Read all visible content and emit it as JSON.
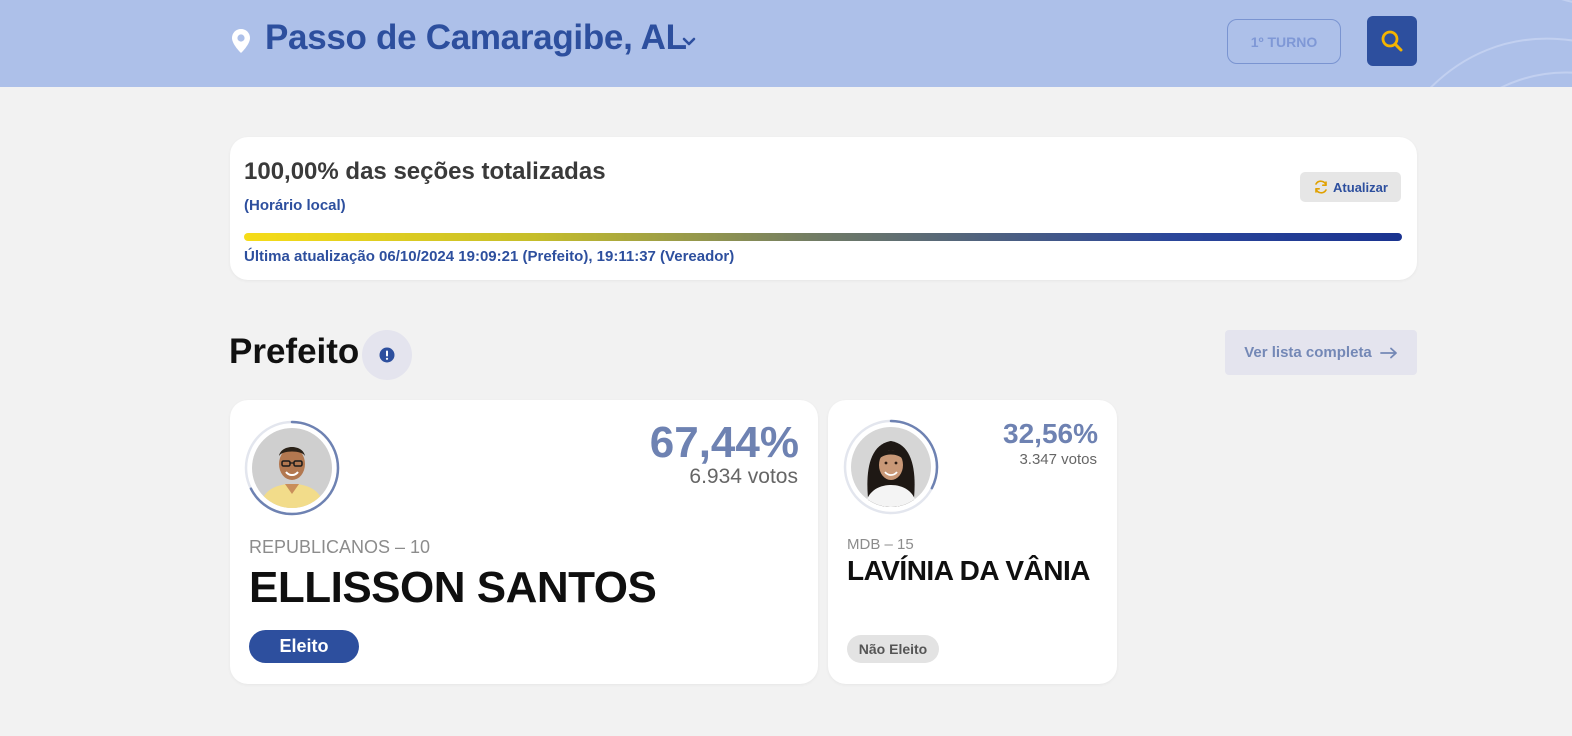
{
  "header": {
    "city": "Passo de Camaragibe, AL",
    "turno_label": "1º TURNO",
    "icons": {
      "location": "location-pin-icon",
      "dropdown": "chevron-down-icon",
      "search": "search-icon"
    },
    "colors": {
      "bar": "#adc0e9",
      "accent": "#2d4f9e",
      "search_icon": "#f4b400"
    }
  },
  "status": {
    "title": "100,00% das seções totalizadas",
    "subtitle": "(Horário local)",
    "refresh_label": "Atualizar",
    "progress": 1.0,
    "updated": "Última atualização 06/10/2024 19:09:21 (Prefeito), 19:11:37 (Vereador)"
  },
  "section": {
    "title": "Prefeito",
    "full_list_label": "Ver lista completa",
    "icons": {
      "info": "info-icon",
      "arrow": "arrow-right-icon"
    }
  },
  "candidates": [
    {
      "percent": "67,44%",
      "votes": "6.934 votos",
      "party": "REPUBLICANOS – 10",
      "name": "ELLISSON SANTOS",
      "status": "Eleito",
      "vote_share": 0.6744
    },
    {
      "percent": "32,56%",
      "votes": "3.347 votos",
      "party": "MDB – 15",
      "name": "LAVÍNIA DA VÂNIA",
      "status": "Não Eleito",
      "vote_share": 0.3256
    }
  ]
}
